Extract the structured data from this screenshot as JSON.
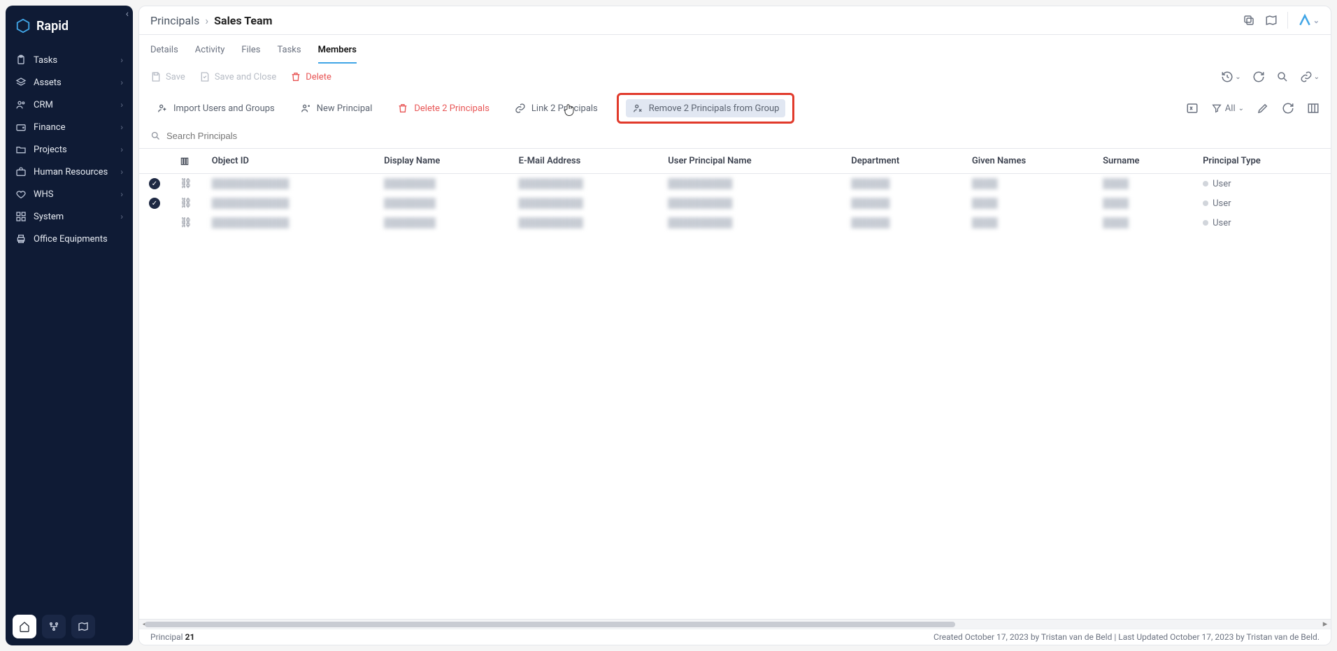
{
  "brand": {
    "name": "Rapid"
  },
  "sidebar": {
    "items": [
      {
        "label": "Tasks",
        "icon": "clipboard"
      },
      {
        "label": "Assets",
        "icon": "layers"
      },
      {
        "label": "CRM",
        "icon": "users"
      },
      {
        "label": "Finance",
        "icon": "wallet"
      },
      {
        "label": "Projects",
        "icon": "folder"
      },
      {
        "label": "Human Resources",
        "icon": "briefcase"
      },
      {
        "label": "WHS",
        "icon": "heart"
      },
      {
        "label": "System",
        "icon": "grid"
      },
      {
        "label": "Office Equipments",
        "icon": "printer"
      }
    ]
  },
  "breadcrumb": {
    "parent": "Principals",
    "current": "Sales Team"
  },
  "tabs": [
    {
      "label": "Details"
    },
    {
      "label": "Activity"
    },
    {
      "label": "Files"
    },
    {
      "label": "Tasks"
    },
    {
      "label": "Members",
      "active": true
    }
  ],
  "save": {
    "save": "Save",
    "save_close": "Save and Close",
    "delete": "Delete"
  },
  "actions": {
    "import": "Import Users and Groups",
    "new": "New Principal",
    "delete_n": "Delete 2 Principals",
    "link_n": "Link 2 Principals",
    "remove_n": "Remove 2 Principals from Group"
  },
  "filter": {
    "label": "All"
  },
  "search": {
    "placeholder": "Search Principals"
  },
  "table": {
    "columns": [
      "Object ID",
      "Display Name",
      "E-Mail Address",
      "User Principal Name",
      "Department",
      "Given Names",
      "Surname",
      "Principal Type"
    ],
    "rows": [
      {
        "selected": true,
        "type": "User"
      },
      {
        "selected": true,
        "type": "User"
      },
      {
        "selected": false,
        "type": "User"
      }
    ]
  },
  "status": {
    "entity": "Principal",
    "count": "21",
    "meta": "Created October 17, 2023 by Tristan van de Beld | Last Updated October 17, 2023 by Tristan van de Beld."
  }
}
